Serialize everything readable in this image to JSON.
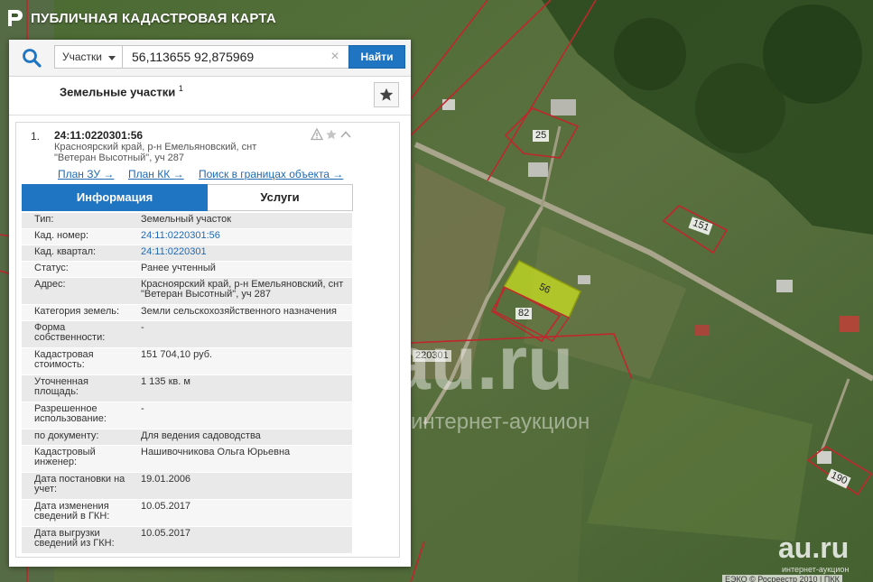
{
  "header": {
    "title": "ПУБЛИЧНАЯ КАДАСТРОВАЯ КАРТА"
  },
  "search": {
    "type_label": "Участки",
    "value": "56,113655 92,875969",
    "clear_glyph": "×",
    "button_label": "Найти"
  },
  "section": {
    "title": "Земельные участки",
    "count": "1"
  },
  "card": {
    "index": "1.",
    "cadnum": "24:11:0220301:56",
    "address_line1": "Красноярский край, р-н Емельяновский, снт",
    "address_line2": "\"Ветеран Высотный\", уч 287",
    "links": {
      "plan_zu": "План ЗУ →",
      "plan_kk": "План КК →",
      "search_bounds": "Поиск в границах объекта →"
    },
    "tabs": {
      "info": "Информация",
      "services": "Услуги"
    }
  },
  "info_rows": [
    {
      "label": "Тип:",
      "value": "Земельный участок",
      "link": false
    },
    {
      "label": "Кад. номер:",
      "value": "24:11:0220301:56",
      "link": true
    },
    {
      "label": "Кад. квартал:",
      "value": "24:11:0220301",
      "link": true
    },
    {
      "label": "Статус:",
      "value": "Ранее учтенный",
      "link": false
    },
    {
      "label": "Адрес:",
      "value": "Красноярский край, р-н Емельяновский, снт \"Ветеран Высотный\", уч 287",
      "link": false
    },
    {
      "label": "Категория земель:",
      "value": "Земли сельскохозяйственного назначения",
      "link": false
    },
    {
      "label": "Форма собственности:",
      "value": "-",
      "link": false
    },
    {
      "label": "Кадастровая стоимость:",
      "value": "151 704,10 руб.",
      "link": false
    },
    {
      "label": "Уточненная площадь:",
      "value": "1 135 кв. м",
      "link": false
    },
    {
      "label": "Разрешенное использование:",
      "value": "-",
      "link": false
    },
    {
      "label": "по документу:",
      "value": "Для ведения садоводства",
      "link": false
    },
    {
      "label": "Кадастровый инженер:",
      "value": "Нашивочникова Ольга Юрьевна",
      "link": false
    },
    {
      "label": "Дата постановки на учет:",
      "value": "19.01.2006",
      "link": false
    },
    {
      "label": "Дата изменения сведений в ГКН:",
      "value": "10.05.2017",
      "link": false
    },
    {
      "label": "Дата выгрузки сведений из ГКН:",
      "value": "10.05.2017",
      "link": false
    }
  ],
  "map": {
    "parcel_labels": [
      "25",
      "151",
      "56",
      "82",
      "190"
    ],
    "quarter_label": "220301",
    "edge_label": "1",
    "watermark_main": "au.ru",
    "watermark_sub": "интернет-аукцион",
    "corner_logo": "au.ru",
    "corner_sub": "интернет-аукцион",
    "copyright": "ЕЭКО © Росреестр 2010 | ПКК"
  },
  "colors": {
    "accent": "#1f75c2",
    "link": "#1f6ab3",
    "parcel_border": "#c0262c",
    "selected_parcel": "#c8e022"
  }
}
